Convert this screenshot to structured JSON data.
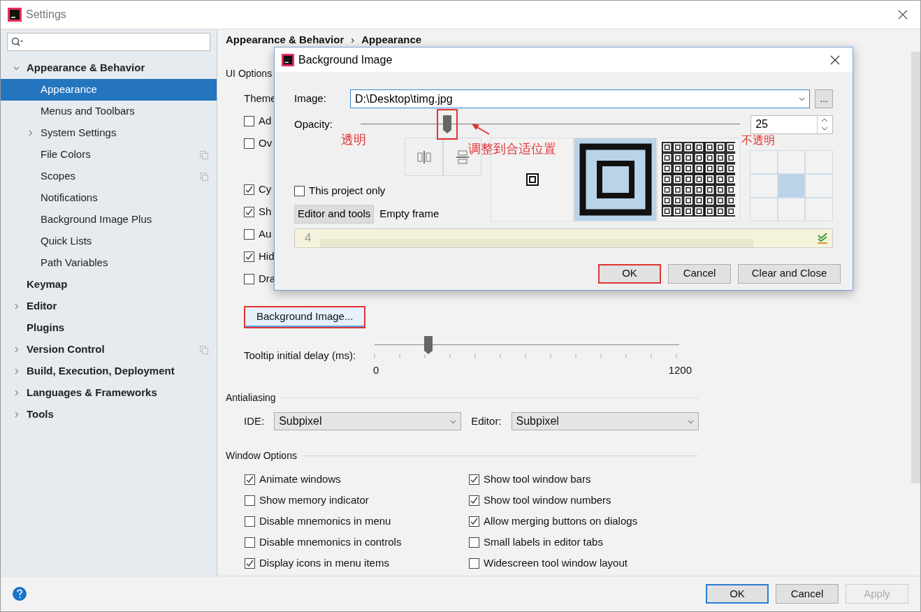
{
  "window": {
    "title": "Settings"
  },
  "sidebar": {
    "items": [
      {
        "label": "Appearance & Behavior",
        "kind": "folder",
        "expanded": true,
        "selected": false,
        "project_level": false,
        "children": [
          {
            "label": "Appearance",
            "kind": "leaf",
            "selected": true,
            "project_level": false
          },
          {
            "label": "Menus and Toolbars",
            "kind": "leaf",
            "selected": false,
            "project_level": false
          },
          {
            "label": "System Settings",
            "kind": "folder",
            "expanded": false,
            "selected": false,
            "project_level": false
          },
          {
            "label": "File Colors",
            "kind": "leaf",
            "selected": false,
            "project_level": true
          },
          {
            "label": "Scopes",
            "kind": "leaf",
            "selected": false,
            "project_level": true
          },
          {
            "label": "Notifications",
            "kind": "leaf",
            "selected": false,
            "project_level": false
          },
          {
            "label": "Background Image Plus",
            "kind": "leaf",
            "selected": false,
            "project_level": false
          },
          {
            "label": "Quick Lists",
            "kind": "leaf",
            "selected": false,
            "project_level": false
          },
          {
            "label": "Path Variables",
            "kind": "leaf",
            "selected": false,
            "project_level": false
          }
        ]
      },
      {
        "label": "Keymap",
        "kind": "leaf",
        "selected": false,
        "project_level": false
      },
      {
        "label": "Editor",
        "kind": "folder",
        "expanded": false,
        "selected": false,
        "project_level": false
      },
      {
        "label": "Plugins",
        "kind": "leaf",
        "selected": false,
        "project_level": false
      },
      {
        "label": "Version Control",
        "kind": "folder",
        "expanded": false,
        "selected": false,
        "project_level": true
      },
      {
        "label": "Build, Execution, Deployment",
        "kind": "folder",
        "expanded": false,
        "selected": false,
        "project_level": false
      },
      {
        "label": "Languages & Frameworks",
        "kind": "folder",
        "expanded": false,
        "selected": false,
        "project_level": false
      },
      {
        "label": "Tools",
        "kind": "folder",
        "expanded": false,
        "selected": false,
        "project_level": false
      }
    ]
  },
  "breadcrumb": {
    "items": [
      "Appearance & Behavior",
      "Appearance"
    ],
    "separator": "›"
  },
  "ui_options": {
    "title": "UI Options",
    "rows": [
      {
        "kind": "text",
        "label": "Theme"
      },
      {
        "kind": "checkbox",
        "label": "Ad",
        "checked": false
      },
      {
        "kind": "checkbox",
        "label": "Ov",
        "checked": false
      },
      {
        "kind": "checkbox",
        "label": "Cy",
        "checked": true
      },
      {
        "kind": "checkbox",
        "label": "Sh",
        "checked": true
      },
      {
        "kind": "checkbox",
        "label": "Au",
        "checked": false
      },
      {
        "kind": "checkbox",
        "label": "Hid",
        "checked": true
      },
      {
        "kind": "checkbox",
        "label": "Dra",
        "checked": false
      }
    ]
  },
  "background_image_button": {
    "label": "Background Image...",
    "highlighted": true
  },
  "tooltip_delay": {
    "label": "Tooltip initial delay (ms):",
    "level": 0.177,
    "min": "0",
    "max": "1200"
  },
  "antialiasing": {
    "title": "Antialiasing",
    "ide_label": "IDE:",
    "ide_value": "Subpixel",
    "editor_label": "Editor:",
    "editor_value": "Subpixel"
  },
  "window_options": {
    "title": "Window Options",
    "items": [
      {
        "label": "Animate windows",
        "checked": true
      },
      {
        "label": "Show tool window bars",
        "checked": true
      },
      {
        "label": "Show memory indicator",
        "checked": false
      },
      {
        "label": "Show tool window numbers",
        "checked": true
      },
      {
        "label": "Disable mnemonics in menu",
        "checked": false
      },
      {
        "label": "Allow merging buttons on dialogs",
        "checked": true
      },
      {
        "label": "Disable mnemonics in controls",
        "checked": false
      },
      {
        "label": "Small labels in editor tabs",
        "checked": false
      },
      {
        "label": "Display icons in menu items",
        "checked": true
      },
      {
        "label": "Widescreen tool window layout",
        "checked": false
      }
    ]
  },
  "footer_buttons": [
    {
      "label": "OK",
      "default": true,
      "disabled": false
    },
    {
      "label": "Cancel",
      "default": false,
      "disabled": false
    },
    {
      "label": "Apply",
      "default": false,
      "disabled": true
    }
  ],
  "dialog": {
    "title": "Background Image",
    "image_label": "Image:",
    "image_value": "D:\\Desktop\\timg.jpg",
    "browse": "...",
    "opacity_label": "Opacity:",
    "opacity": {
      "level": 0.25,
      "highlighted": true
    },
    "opacity_value": "25",
    "fill_modes": [
      {
        "kind": "center",
        "selected": false
      },
      {
        "kind": "scale",
        "selected": true
      },
      {
        "kind": "tile",
        "selected": false
      }
    ],
    "anchors": [
      {
        "selected": false
      },
      {
        "selected": false
      },
      {
        "selected": false
      },
      {
        "selected": false
      },
      {
        "selected": true
      },
      {
        "selected": false
      },
      {
        "selected": false
      },
      {
        "selected": false
      },
      {
        "selected": false
      }
    ],
    "this_project_only": {
      "label": "This project only",
      "checked": false
    },
    "targets": [
      {
        "label": "Editor and tools",
        "selected": true
      },
      {
        "label": "Empty frame",
        "selected": false
      }
    ],
    "preview_text": "4",
    "buttons": [
      {
        "label": "OK",
        "default": true,
        "highlighted": true
      },
      {
        "label": "Cancel",
        "default": false,
        "highlighted": false
      },
      {
        "label": "Clear and Close",
        "default": false,
        "highlighted": false
      }
    ]
  },
  "annotations": [
    {
      "kind": "left",
      "text": "透明"
    },
    {
      "kind": "thumb",
      "text": "调整到合适位置"
    },
    {
      "kind": "right",
      "text": "不透明"
    }
  ]
}
